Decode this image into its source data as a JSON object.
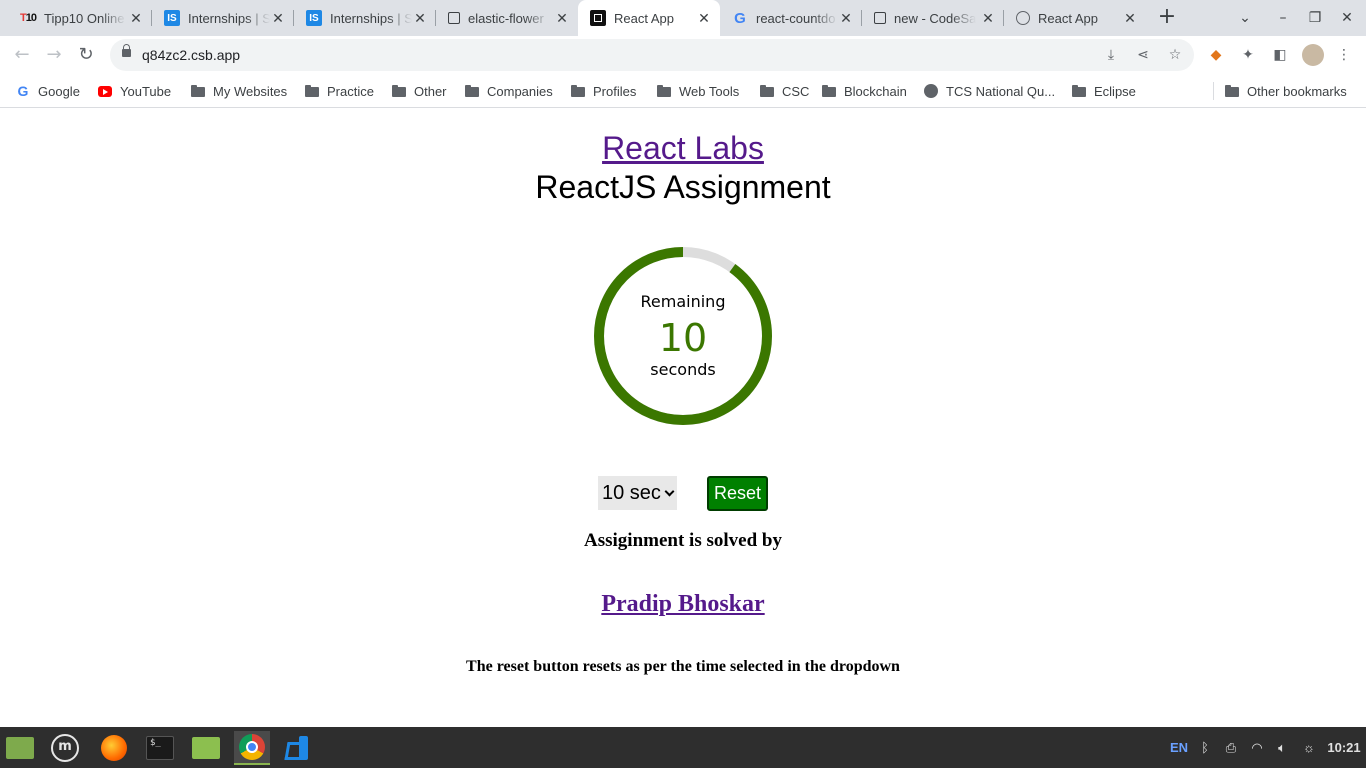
{
  "browser": {
    "tabs": [
      {
        "title": "Tipp10 Online",
        "icon": "tipp10-icon",
        "active": false
      },
      {
        "title": "Internships | S",
        "icon": "internshala-icon",
        "active": false
      },
      {
        "title": "Internships | S",
        "icon": "internshala-icon",
        "active": false
      },
      {
        "title": "elastic-flower",
        "icon": "codesandbox-icon",
        "active": false
      },
      {
        "title": "React App",
        "icon": "react-app-icon",
        "active": true
      },
      {
        "title": "react-countdo",
        "icon": "google-icon",
        "active": false
      },
      {
        "title": "new - CodeSa",
        "icon": "codesandbox-icon",
        "active": false
      },
      {
        "title": "React App",
        "icon": "globe-icon",
        "active": false
      }
    ],
    "url": "q84zc2.csb.app",
    "bookmarks": [
      {
        "label": "Google",
        "icon": "google-icon"
      },
      {
        "label": "YouTube",
        "icon": "youtube-icon"
      },
      {
        "label": "My Websites",
        "icon": "folder-icon"
      },
      {
        "label": "Practice",
        "icon": "folder-icon"
      },
      {
        "label": "Other",
        "icon": "folder-icon"
      },
      {
        "label": "Companies",
        "icon": "folder-icon"
      },
      {
        "label": "Profiles",
        "icon": "folder-icon"
      },
      {
        "label": "Web Tools",
        "icon": "folder-icon"
      },
      {
        "label": "CSC",
        "icon": "folder-icon"
      },
      {
        "label": "Blockchain",
        "icon": "folder-icon"
      },
      {
        "label": "TCS National Qu...",
        "icon": "globe-icon"
      },
      {
        "label": "Eclipse",
        "icon": "folder-icon"
      }
    ],
    "other_bookmarks": "Other bookmarks"
  },
  "page": {
    "brand_link": "React Labs",
    "subtitle": "ReactJS Assignment",
    "timer": {
      "label": "Remaining",
      "value": "10",
      "unit": "seconds",
      "progress_fraction": 0.9,
      "progress_color": "#3b7700",
      "track_color": "#dddddd"
    },
    "duration_select": {
      "selected": "10 sec"
    },
    "reset_label": "Reset",
    "solved_by": "Assiginment is solved by",
    "author": "Pradip Bhoskar",
    "note": "The reset button resets as per the time selected in the dropdown"
  },
  "taskbar": {
    "apps": [
      "files-icon",
      "mint-menu-icon",
      "firefox-icon",
      "terminal-icon",
      "file-manager-icon",
      "chrome-icon",
      "vscode-icon"
    ],
    "tray": {
      "language": "EN",
      "time": "10:21"
    }
  }
}
